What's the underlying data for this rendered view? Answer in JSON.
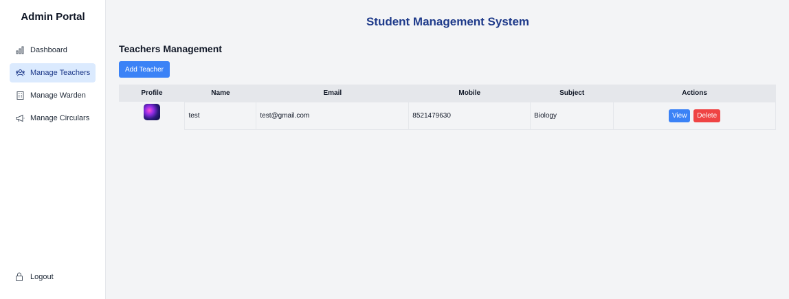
{
  "sidebar": {
    "brand": "Admin Portal",
    "items": [
      {
        "label": "Dashboard",
        "icon": "bar-chart-icon",
        "active": false
      },
      {
        "label": "Manage Teachers",
        "icon": "teachers-icon",
        "active": true
      },
      {
        "label": "Manage Warden",
        "icon": "building-icon",
        "active": false
      },
      {
        "label": "Manage Circulars",
        "icon": "megaphone-icon",
        "active": false
      }
    ],
    "logout_label": "Logout"
  },
  "header": {
    "title": "Student Management System"
  },
  "section": {
    "title": "Teachers Management",
    "add_button_label": "Add Teacher"
  },
  "table": {
    "columns": [
      "Profile",
      "Name",
      "Email",
      "Mobile",
      "Subject",
      "Actions"
    ],
    "rows": [
      {
        "name": "test",
        "email": "test@gmail.com",
        "mobile": "8521479630",
        "subject": "Biology",
        "view_label": "View",
        "delete_label": "Delete"
      }
    ]
  },
  "colors": {
    "accent": "#3b82f6",
    "danger": "#ef4444",
    "title": "#1e3a8a",
    "active_bg": "#dbeafe"
  }
}
